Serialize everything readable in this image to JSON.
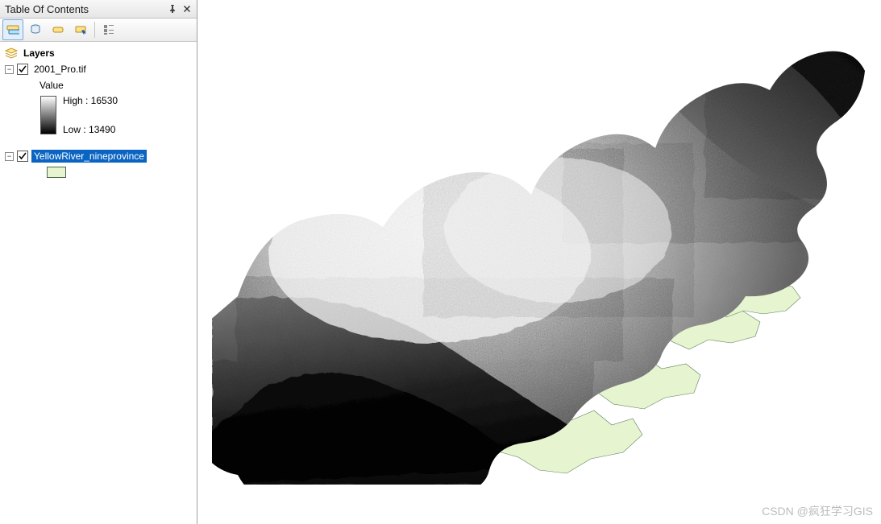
{
  "panel": {
    "title": "Table Of Contents",
    "pin_tooltip": "Auto Hide",
    "close_tooltip": "Close"
  },
  "toolbar": {
    "btn_draworder": "List By Drawing Order",
    "btn_source": "List By Source",
    "btn_visibility": "List By Visibility",
    "btn_selection": "List By Selection",
    "btn_options": "Options"
  },
  "tree": {
    "root_label": "Layers",
    "layers": [
      {
        "name": "2001_Pro.tif",
        "visible": true,
        "expanded": true,
        "type": "raster",
        "value_label": "Value",
        "high_label": "High : 16530",
        "low_label": "Low : 13490",
        "high": 16530,
        "low": 13490,
        "selected": false
      },
      {
        "name": "YellowRiver_nineprovince",
        "visible": true,
        "expanded": true,
        "type": "polygon",
        "fill": "#e6f5d0",
        "selected": true
      }
    ]
  },
  "watermark": "CSDN @疯狂学习GIS"
}
